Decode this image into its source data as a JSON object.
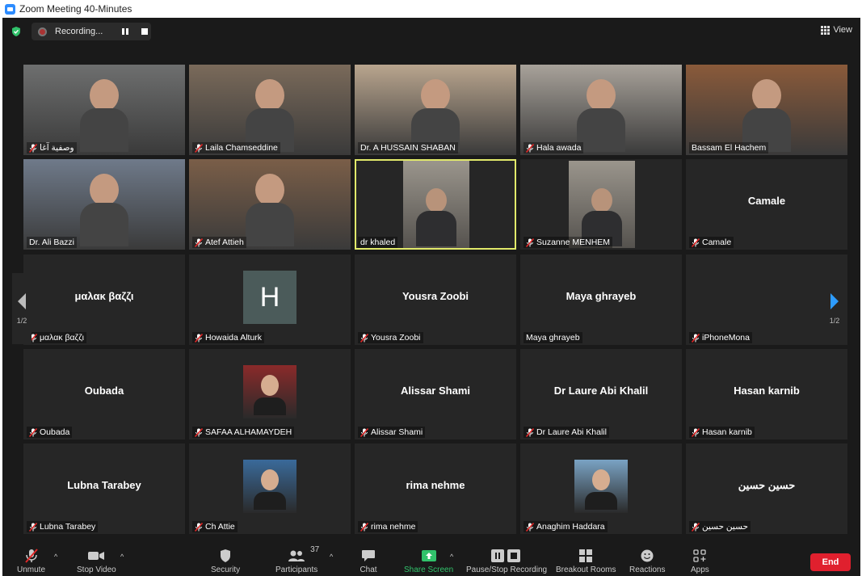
{
  "window": {
    "title": "Zoom Meeting 40-Minutes"
  },
  "topbar": {
    "recording_label": "Recording...",
    "view_label": "View"
  },
  "pagination": {
    "left": "1/2",
    "right": "1/2"
  },
  "tiles": [
    {
      "name": "وصفية آغا",
      "big": "",
      "type": "video",
      "muted": true,
      "bg": "#6e6f6f"
    },
    {
      "name": "Laila Chamseddine",
      "big": "",
      "type": "video",
      "muted": true,
      "bg": "#7a6a5a"
    },
    {
      "name": "Dr. A HUSSAIN SHABAN",
      "big": "",
      "type": "video",
      "muted": false,
      "bg": "#b9a58e"
    },
    {
      "name": "Hala awada",
      "big": "",
      "type": "video",
      "muted": true,
      "bg": "#a8a29a"
    },
    {
      "name": "Bassam El Hachem",
      "big": "",
      "type": "video",
      "muted": false,
      "bg": "#8a5a3a"
    },
    {
      "name": "Dr. Ali Bazzi",
      "big": "",
      "type": "video",
      "muted": false,
      "bg": "#6f7a8a"
    },
    {
      "name": "Atef Attieh",
      "big": "",
      "type": "video",
      "muted": true,
      "bg": "#7a5e48"
    },
    {
      "name": "dr khaled",
      "big": "",
      "type": "video-small",
      "muted": false,
      "bg": "#262626",
      "active": true
    },
    {
      "name": "Suzanne MENHEM",
      "big": "",
      "type": "video-small",
      "muted": true,
      "bg": "#262626"
    },
    {
      "name": "Camale",
      "big": "Camale",
      "type": "name",
      "muted": true
    },
    {
      "name": "μαλακ βαζζι",
      "big": "μαλακ βαζζι",
      "type": "name",
      "muted": true
    },
    {
      "name": "Howaida Alturk",
      "big": "",
      "type": "letter",
      "letter": "H",
      "muted": true
    },
    {
      "name": "Yousra Zoobi",
      "big": "Yousra Zoobi",
      "type": "name",
      "muted": true
    },
    {
      "name": "Maya ghrayeb",
      "big": "Maya ghrayeb",
      "type": "name",
      "muted": false
    },
    {
      "name": "iPhoneMona",
      "big": "",
      "type": "name",
      "muted": true
    },
    {
      "name": "Oubada",
      "big": "Oubada",
      "type": "name",
      "muted": true
    },
    {
      "name": "SAFAA ALHAMAYDEH",
      "big": "",
      "type": "photo",
      "muted": true,
      "photo": "#8a2a2a"
    },
    {
      "name": "Alissar Shami",
      "big": "Alissar Shami",
      "type": "name",
      "muted": true
    },
    {
      "name": "Dr Laure Abi Khalil",
      "big": "Dr Laure Abi Khalil",
      "type": "name",
      "muted": true
    },
    {
      "name": "Hasan karnib",
      "big": "Hasan karnib",
      "type": "name",
      "muted": true
    },
    {
      "name": "Lubna Tarabey",
      "big": "Lubna Tarabey",
      "type": "name",
      "muted": true
    },
    {
      "name": "Ch Attie",
      "big": "",
      "type": "photo",
      "muted": true,
      "photo": "#3a6a9a"
    },
    {
      "name": "rima nehme",
      "big": "rima nehme",
      "type": "name",
      "muted": true
    },
    {
      "name": "Anaghim Haddara",
      "big": "",
      "type": "photo",
      "muted": true,
      "photo": "#7aa3c4"
    },
    {
      "name": "حسين حسين",
      "big": "حسين حسين",
      "type": "name",
      "muted": true
    }
  ],
  "toolbar": {
    "unmute": "Unmute",
    "stop_video": "Stop Video",
    "security": "Security",
    "participants": "Participants",
    "participants_count": "37",
    "chat": "Chat",
    "share_screen": "Share Screen",
    "pause_stop_recording": "Pause/Stop Recording",
    "breakout_rooms": "Breakout Rooms",
    "reactions": "Reactions",
    "apps": "Apps",
    "end": "End"
  },
  "colors": {
    "accent": "#2d8cff",
    "share": "#31c26b",
    "end": "#e0202e",
    "active_border": "#e1e96a",
    "muted": "#e02828"
  }
}
